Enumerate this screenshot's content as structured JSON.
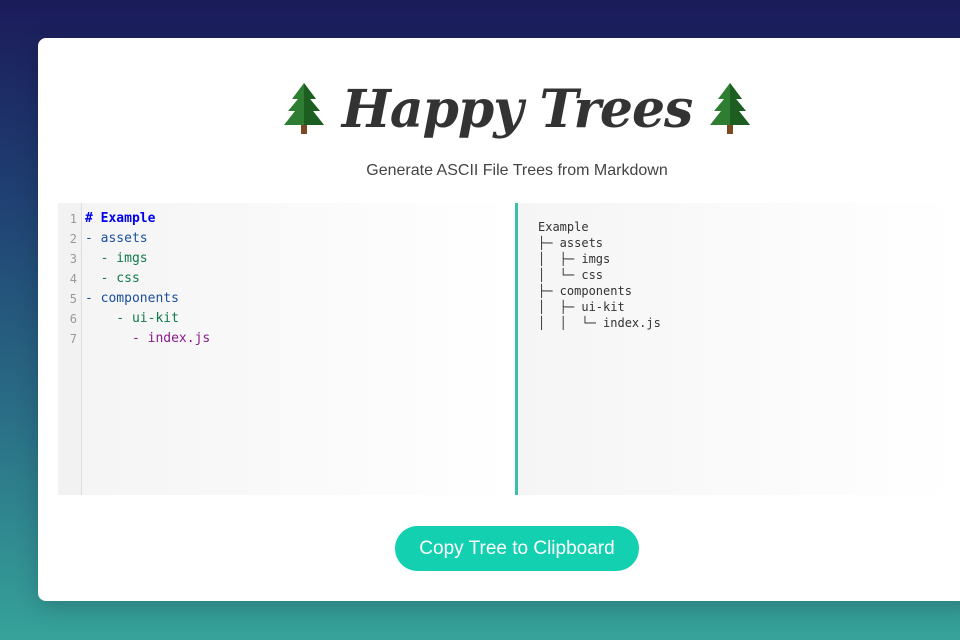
{
  "header": {
    "title": "Happy Trees",
    "subtitle": "Generate ASCII File Trees from Markdown",
    "icon": "pine-tree-icon",
    "icon_color": "#2e7d32"
  },
  "editor": {
    "line_numbers": [
      "1",
      "2",
      "3",
      "4",
      "5",
      "6",
      "7"
    ],
    "lines": [
      "# Example",
      "- assets",
      "  - imgs",
      "  - css",
      "- components",
      "    - ui-kit",
      "      - index.js"
    ]
  },
  "output": {
    "tree_text": "Example\n├─ assets\n│  ├─ imgs\n│  └─ css\n├─ components\n│  ├─ ui-kit\n│  │  └─ index.js"
  },
  "actions": {
    "copy_label": "Copy Tree to Clipboard",
    "accent_color": "#12d0b0"
  }
}
